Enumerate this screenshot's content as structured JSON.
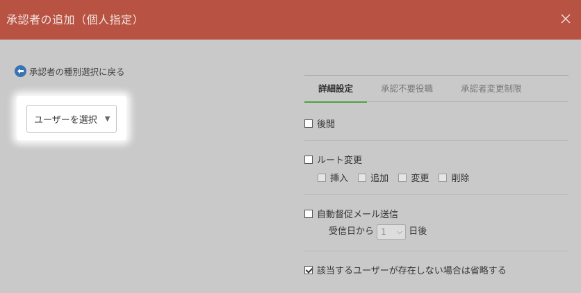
{
  "header": {
    "title": "承認者の追加（個人指定）"
  },
  "back_link": {
    "label": "承認者の種別選択に戻る"
  },
  "user_select": {
    "label": "ユーザーを選択",
    "arrow": "▼"
  },
  "tabs": [
    {
      "label": "詳細設定",
      "active": true
    },
    {
      "label": "承認不要役職",
      "active": false
    },
    {
      "label": "承認者変更制限",
      "active": false
    }
  ],
  "options": {
    "kouetsu": {
      "label": "後閲",
      "checked": false
    },
    "route_change": {
      "label": "ルート変更",
      "checked": false,
      "sub": [
        {
          "label": "挿入",
          "checked": false
        },
        {
          "label": "追加",
          "checked": false
        },
        {
          "label": "変更",
          "checked": false
        },
        {
          "label": "削除",
          "checked": false
        }
      ]
    },
    "auto_reminder": {
      "label": "自動督促メール送信",
      "checked": false,
      "prefix": "受信日から",
      "days_value": "1",
      "suffix": "日後"
    },
    "skip_missing": {
      "label": "該当するユーザーが存在しない場合は省略する",
      "checked": true
    }
  },
  "colors": {
    "header": "#b85242",
    "accent_tab": "#4aa33e",
    "back_icon": "#3a73b4"
  }
}
